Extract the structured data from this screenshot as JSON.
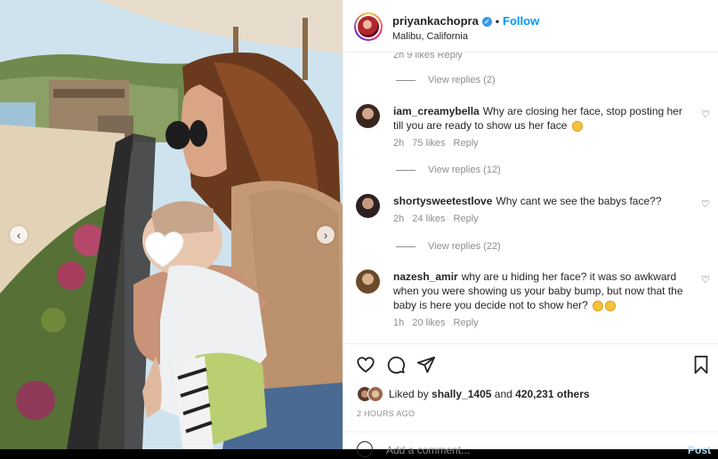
{
  "post": {
    "username": "priyankachopra",
    "follow_label": "Follow",
    "location": "Malibu, California"
  },
  "comments_cut": {
    "meta": "2h 9 likes Reply"
  },
  "replies": [
    {
      "label": "View replies (2)"
    },
    {
      "label": "View replies (12)"
    },
    {
      "label": "View replies (22)"
    }
  ],
  "comments": [
    {
      "user": "iam_creamybella",
      "text": "Why are closing her face, stop posting her till you are ready to show us her face",
      "time": "2h",
      "likes": "75 likes",
      "reply": "Reply"
    },
    {
      "user": "shortysweetestlove",
      "text": "Why cant we see the babys face??",
      "time": "2h",
      "likes": "24 likes",
      "reply": "Reply"
    },
    {
      "user": "nazesh_amir",
      "text": "why are u hiding her face? it was so awkward when you were showing us your baby bump, but now that the baby is here you decide not to show her?",
      "time": "1h",
      "likes": "20 likes",
      "reply": "Reply"
    }
  ],
  "likes": {
    "prefix": "Liked by",
    "user": "shally_1405",
    "and": "and",
    "count": "420,231 others"
  },
  "timestamp": "2 HOURS AGO",
  "add_comment": {
    "placeholder": "Add a comment...",
    "post_label": "Post"
  },
  "icons": {
    "like": "heart-icon",
    "comment": "comment-icon",
    "share": "send-icon",
    "save": "bookmark-icon",
    "emoji": "smiley-icon",
    "verified": "verified-badge-icon"
  },
  "colors": {
    "link": "#0095f6",
    "muted": "#8e8e8e",
    "verified": "#3897f0"
  }
}
